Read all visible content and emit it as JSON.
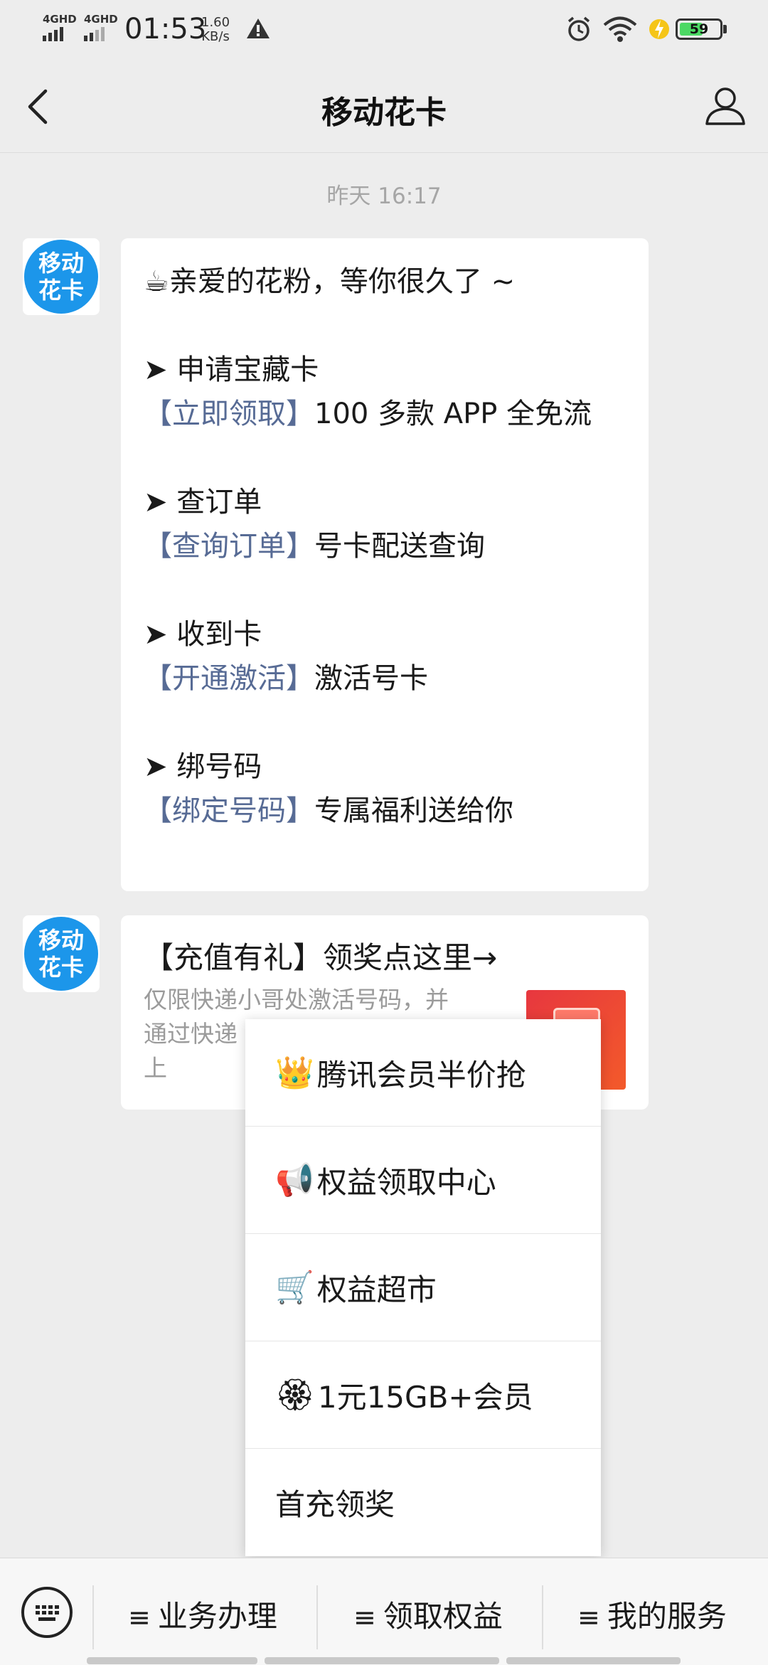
{
  "status_bar": {
    "signal1": "4GHD",
    "signal2": "4GHD",
    "time": "01:53",
    "speed_value": "1.60",
    "speed_unit": "KB/s",
    "battery": "59"
  },
  "nav": {
    "title": "移动花卡"
  },
  "timestamp": "昨天 16:17",
  "avatar_text_line1": "移动",
  "avatar_text_line2": "花卡",
  "message1": {
    "greeting": "☕亲爱的花粉，等你很久了 ~",
    "sections": [
      {
        "heading": "➤ 申请宝藏卡",
        "link": "立即领取",
        "desc": "100 多款 APP 全免流"
      },
      {
        "heading": "➤ 查订单",
        "link": "查询订单",
        "desc": "号卡配送查询"
      },
      {
        "heading": "➤ 收到卡",
        "link": "开通激活",
        "desc": "激活号卡"
      },
      {
        "heading": "➤  绑号码",
        "link": "绑定号码",
        "desc": "专属福利送给你"
      }
    ]
  },
  "message2": {
    "title": "【充值有礼】领奖点这里→",
    "desc_line1": "仅限快递小哥处激活号码，并",
    "desc_line2": "通过快递",
    "desc_line3": "上"
  },
  "popup_menu": [
    {
      "icon": "👑",
      "label": "腾讯会员半价抢"
    },
    {
      "icon": "📢",
      "label": "权益领取中心"
    },
    {
      "icon": "🛒",
      "label": "权益超市"
    },
    {
      "icon": "🏵",
      "label": "1元15GB+会员"
    },
    {
      "icon": "",
      "label": "首充领奖"
    }
  ],
  "bottom_menu": [
    {
      "label": "业务办理"
    },
    {
      "label": "领取权益"
    },
    {
      "label": "我的服务"
    }
  ],
  "colors": {
    "background": "#ededed",
    "link": "#576b95",
    "avatar": "#1c96ea"
  }
}
